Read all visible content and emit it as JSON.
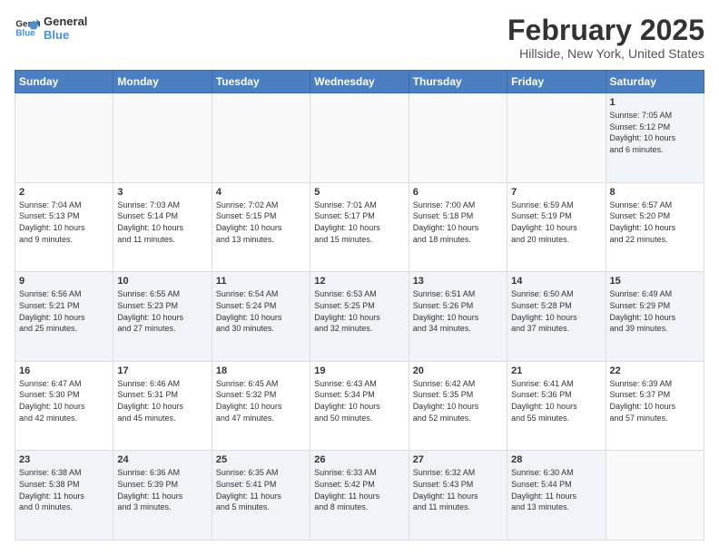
{
  "logo": {
    "text1": "General",
    "text2": "Blue"
  },
  "title": "February 2025",
  "subtitle": "Hillside, New York, United States",
  "days_of_week": [
    "Sunday",
    "Monday",
    "Tuesday",
    "Wednesday",
    "Thursday",
    "Friday",
    "Saturday"
  ],
  "weeks": [
    [
      {
        "day": "",
        "info": ""
      },
      {
        "day": "",
        "info": ""
      },
      {
        "day": "",
        "info": ""
      },
      {
        "day": "",
        "info": ""
      },
      {
        "day": "",
        "info": ""
      },
      {
        "day": "",
        "info": ""
      },
      {
        "day": "1",
        "info": "Sunrise: 7:05 AM\nSunset: 5:12 PM\nDaylight: 10 hours\nand 6 minutes."
      }
    ],
    [
      {
        "day": "2",
        "info": "Sunrise: 7:04 AM\nSunset: 5:13 PM\nDaylight: 10 hours\nand 9 minutes."
      },
      {
        "day": "3",
        "info": "Sunrise: 7:03 AM\nSunset: 5:14 PM\nDaylight: 10 hours\nand 11 minutes."
      },
      {
        "day": "4",
        "info": "Sunrise: 7:02 AM\nSunset: 5:15 PM\nDaylight: 10 hours\nand 13 minutes."
      },
      {
        "day": "5",
        "info": "Sunrise: 7:01 AM\nSunset: 5:17 PM\nDaylight: 10 hours\nand 15 minutes."
      },
      {
        "day": "6",
        "info": "Sunrise: 7:00 AM\nSunset: 5:18 PM\nDaylight: 10 hours\nand 18 minutes."
      },
      {
        "day": "7",
        "info": "Sunrise: 6:59 AM\nSunset: 5:19 PM\nDaylight: 10 hours\nand 20 minutes."
      },
      {
        "day": "8",
        "info": "Sunrise: 6:57 AM\nSunset: 5:20 PM\nDaylight: 10 hours\nand 22 minutes."
      }
    ],
    [
      {
        "day": "9",
        "info": "Sunrise: 6:56 AM\nSunset: 5:21 PM\nDaylight: 10 hours\nand 25 minutes."
      },
      {
        "day": "10",
        "info": "Sunrise: 6:55 AM\nSunset: 5:23 PM\nDaylight: 10 hours\nand 27 minutes."
      },
      {
        "day": "11",
        "info": "Sunrise: 6:54 AM\nSunset: 5:24 PM\nDaylight: 10 hours\nand 30 minutes."
      },
      {
        "day": "12",
        "info": "Sunrise: 6:53 AM\nSunset: 5:25 PM\nDaylight: 10 hours\nand 32 minutes."
      },
      {
        "day": "13",
        "info": "Sunrise: 6:51 AM\nSunset: 5:26 PM\nDaylight: 10 hours\nand 34 minutes."
      },
      {
        "day": "14",
        "info": "Sunrise: 6:50 AM\nSunset: 5:28 PM\nDaylight: 10 hours\nand 37 minutes."
      },
      {
        "day": "15",
        "info": "Sunrise: 6:49 AM\nSunset: 5:29 PM\nDaylight: 10 hours\nand 39 minutes."
      }
    ],
    [
      {
        "day": "16",
        "info": "Sunrise: 6:47 AM\nSunset: 5:30 PM\nDaylight: 10 hours\nand 42 minutes."
      },
      {
        "day": "17",
        "info": "Sunrise: 6:46 AM\nSunset: 5:31 PM\nDaylight: 10 hours\nand 45 minutes."
      },
      {
        "day": "18",
        "info": "Sunrise: 6:45 AM\nSunset: 5:32 PM\nDaylight: 10 hours\nand 47 minutes."
      },
      {
        "day": "19",
        "info": "Sunrise: 6:43 AM\nSunset: 5:34 PM\nDaylight: 10 hours\nand 50 minutes."
      },
      {
        "day": "20",
        "info": "Sunrise: 6:42 AM\nSunset: 5:35 PM\nDaylight: 10 hours\nand 52 minutes."
      },
      {
        "day": "21",
        "info": "Sunrise: 6:41 AM\nSunset: 5:36 PM\nDaylight: 10 hours\nand 55 minutes."
      },
      {
        "day": "22",
        "info": "Sunrise: 6:39 AM\nSunset: 5:37 PM\nDaylight: 10 hours\nand 57 minutes."
      }
    ],
    [
      {
        "day": "23",
        "info": "Sunrise: 6:38 AM\nSunset: 5:38 PM\nDaylight: 11 hours\nand 0 minutes."
      },
      {
        "day": "24",
        "info": "Sunrise: 6:36 AM\nSunset: 5:39 PM\nDaylight: 11 hours\nand 3 minutes."
      },
      {
        "day": "25",
        "info": "Sunrise: 6:35 AM\nSunset: 5:41 PM\nDaylight: 11 hours\nand 5 minutes."
      },
      {
        "day": "26",
        "info": "Sunrise: 6:33 AM\nSunset: 5:42 PM\nDaylight: 11 hours\nand 8 minutes."
      },
      {
        "day": "27",
        "info": "Sunrise: 6:32 AM\nSunset: 5:43 PM\nDaylight: 11 hours\nand 11 minutes."
      },
      {
        "day": "28",
        "info": "Sunrise: 6:30 AM\nSunset: 5:44 PM\nDaylight: 11 hours\nand 13 minutes."
      },
      {
        "day": "",
        "info": ""
      }
    ]
  ]
}
